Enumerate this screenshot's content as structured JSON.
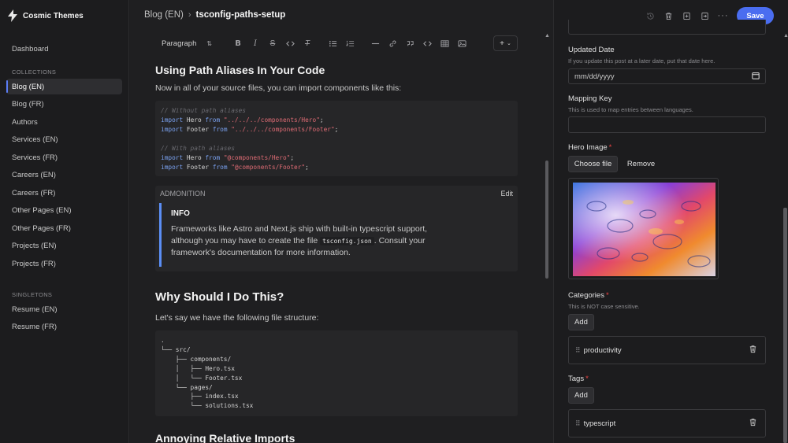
{
  "app": {
    "name": "Cosmic Themes"
  },
  "sidebar": {
    "dashboard": "Dashboard",
    "collections_label": "COLLECTIONS",
    "collections": [
      {
        "label": "Blog (EN)",
        "active": true
      },
      {
        "label": "Blog (FR)"
      },
      {
        "label": "Authors"
      },
      {
        "label": "Services (EN)"
      },
      {
        "label": "Services (FR)"
      },
      {
        "label": "Careers (EN)"
      },
      {
        "label": "Careers (FR)"
      },
      {
        "label": "Other Pages (EN)"
      },
      {
        "label": "Other Pages (FR)"
      },
      {
        "label": "Projects (EN)"
      },
      {
        "label": "Projects (FR)"
      }
    ],
    "singletons_label": "SINGLETONS",
    "singletons": [
      {
        "label": "Resume (EN)"
      },
      {
        "label": "Resume (FR)"
      }
    ]
  },
  "breadcrumb": {
    "parent": "Blog (EN)",
    "separator": "›",
    "current": "tsconfig-paths-setup"
  },
  "toolbar": {
    "block_type": "Paragraph",
    "insert_label": "+"
  },
  "content": {
    "h1": "Using Path Aliases In Your Code",
    "p1": "Now in all of your source files, you can import components like this:",
    "code1": {
      "comment1": "// Without path aliases",
      "line1": {
        "kw1": "import",
        "name": "Hero",
        "kw2": "from",
        "path": "\"../../../components/Hero\"",
        "end": ";"
      },
      "line2": {
        "kw1": "import",
        "name": "Footer",
        "kw2": "from",
        "path": "\"../../../components/Footer\"",
        "end": ";"
      },
      "comment2": "// With path aliases",
      "line3": {
        "kw1": "import",
        "name": "Hero",
        "kw2": "from",
        "path": "\"@components/Hero\"",
        "end": ";"
      },
      "line4": {
        "kw1": "import",
        "name": "Footer",
        "kw2": "from",
        "path": "\"@components/Footer\"",
        "end": ";"
      }
    },
    "admonition": {
      "label": "ADMONITION",
      "edit": "Edit",
      "title": "INFO",
      "text_before": "Frameworks like Astro and Next.js ship with built-in typescript support, although you may have to create the file ",
      "code": "tsconfig.json",
      "text_after": ". Consult your framework's documentation for more information."
    },
    "h2": "Why Should I Do This?",
    "p2": "Let's say we have the following file structure:",
    "tree": ".\n└── src/\n    ├── components/\n    │   ├── Hero.tsx\n    │   └── Footer.tsx\n    └── pages/\n        ├── index.tsx\n        └── solutions.tsx",
    "h3": "Annoying Relative Imports"
  },
  "panel": {
    "save": "Save",
    "updated_date": {
      "label": "Updated Date",
      "help": "If you update this post at a later date, put that date here.",
      "placeholder": "mm/dd/yyyy"
    },
    "mapping_key": {
      "label": "Mapping Key",
      "help": "This is used to map entries between languages.",
      "value": ""
    },
    "hero_image": {
      "label": "Hero Image",
      "required": "*",
      "choose": "Choose file",
      "remove": "Remove"
    },
    "categories": {
      "label": "Categories",
      "required": "*",
      "help": "This is NOT case sensitive.",
      "add": "Add",
      "items": [
        "productivity"
      ]
    },
    "tags": {
      "label": "Tags",
      "required": "*",
      "add": "Add",
      "items": [
        "typescript"
      ]
    }
  },
  "colors": {
    "accent": "#4a6df0",
    "admonition_border": "#5b8ef5",
    "required": "#ef4444"
  }
}
